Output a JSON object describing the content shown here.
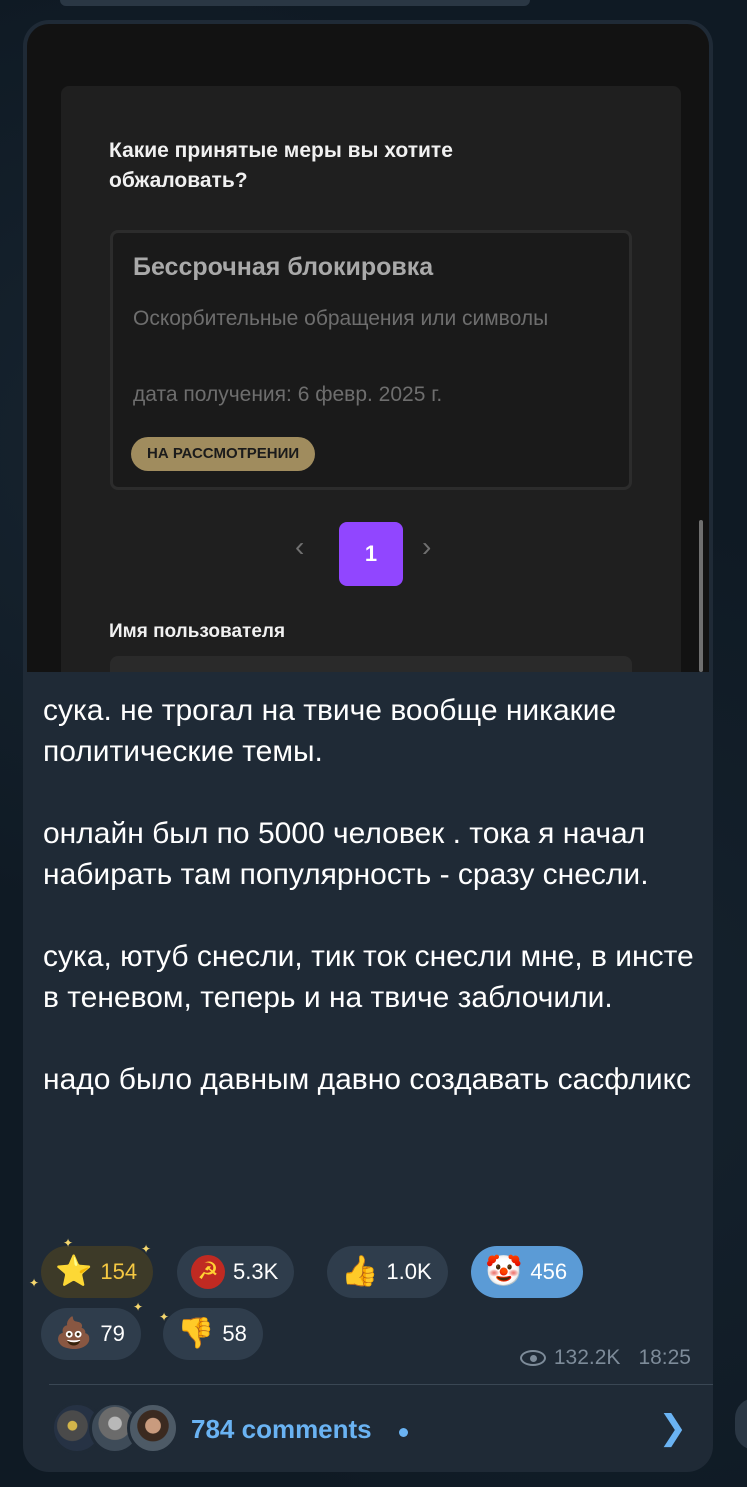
{
  "media": {
    "question": "Какие принятые меры вы хотите обжаловать?",
    "appeal": {
      "title": "Бессрочная блокировка",
      "reason": "Оскорбительные обращения или символы",
      "date": "дата получения: 6 февр. 2025 г.",
      "status": "НА РАССМОТРЕНИИ"
    },
    "pagination": {
      "prev": "‹",
      "current": "1",
      "next": "›"
    },
    "username_label": "Имя пользователя"
  },
  "message": {
    "text": "сука. не трогал на твиче вообще никакие политические темы.\n\nонлайн был по 5000 человек . тока я начал набирать там популярность - сразу снесли.\n\nсука, ютуб снесли, тик ток снесли мне, в инсте в теневом, теперь и на твиче заблочили.\n\nнадо было давным давно создавать сасфликс"
  },
  "reactions": [
    {
      "emoji": "⭐",
      "count": "154",
      "icon": "star-icon"
    },
    {
      "emoji": "☭",
      "count": "5.3K",
      "icon": "hammer-sickle-icon"
    },
    {
      "emoji": "👍",
      "count": "1.0K",
      "icon": "thumbs-up-icon"
    },
    {
      "emoji": "🤡",
      "count": "456",
      "icon": "clown-icon"
    },
    {
      "emoji": "💩",
      "count": "79",
      "icon": "poop-icon"
    },
    {
      "emoji": "👎",
      "count": "58",
      "icon": "thumbs-down-icon"
    }
  ],
  "meta": {
    "views": "132.2K",
    "time": "18:25"
  },
  "comments": {
    "label": "784 comments"
  },
  "colors": {
    "accent": "#6ab3f3",
    "twitch_purple": "#9146ff",
    "bubble": "#1f2a36"
  }
}
